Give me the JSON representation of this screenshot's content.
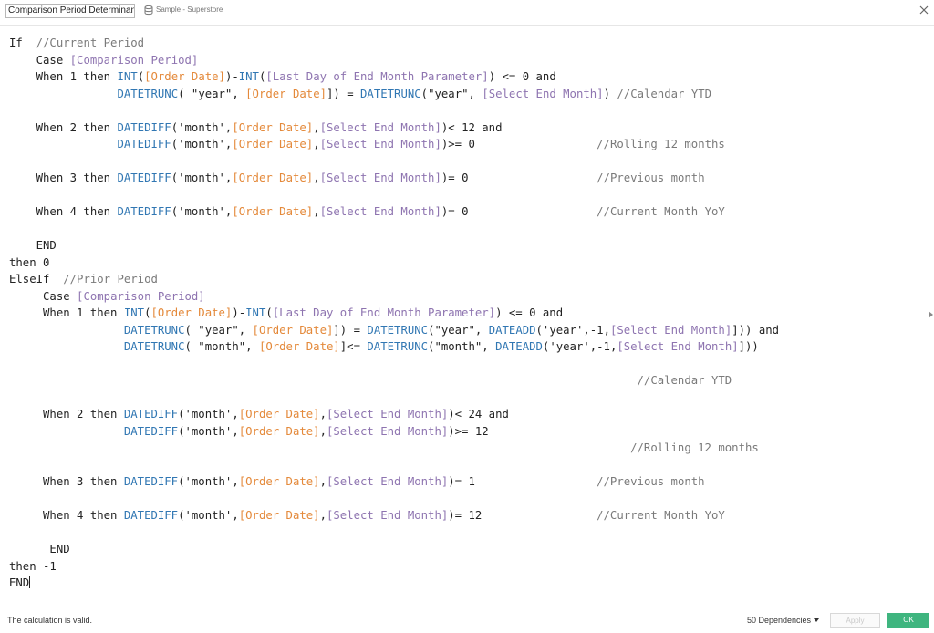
{
  "header": {
    "calculation_name": "Comparison Period Determinant",
    "data_source": "Sample - Superstore",
    "data_source_icon": "datasource-icon",
    "close_icon": "close-icon"
  },
  "code_lines": [
    [
      [
        "kw",
        "If  "
      ],
      [
        "comment",
        "//Current Period"
      ]
    ],
    [
      [
        "kw",
        "    Case "
      ],
      [
        "param",
        "[Comparison Period]"
      ]
    ],
    [
      [
        "kw",
        "    When 1 then "
      ],
      [
        "func",
        "INT"
      ],
      [
        "op",
        "("
      ],
      [
        "field",
        "[Order Date]"
      ],
      [
        "op",
        ")-"
      ],
      [
        "func",
        "INT"
      ],
      [
        "op",
        "("
      ],
      [
        "param",
        "[Last Day of End Month Parameter]"
      ],
      [
        "op",
        ") <= 0 and"
      ]
    ],
    [
      [
        "kw",
        "                "
      ],
      [
        "func",
        "DATETRUNC"
      ],
      [
        "op",
        "( \"year\", "
      ],
      [
        "field",
        "[Order Date]"
      ],
      [
        "op",
        "]) = "
      ],
      [
        "func",
        "DATETRUNC"
      ],
      [
        "op",
        "(\"year\", "
      ],
      [
        "param",
        "[Select End Month]"
      ],
      [
        "op",
        ") "
      ],
      [
        "comment",
        "//Calendar YTD"
      ]
    ],
    [
      [
        "kw",
        ""
      ]
    ],
    [
      [
        "kw",
        "    When 2 then "
      ],
      [
        "func",
        "DATEDIFF"
      ],
      [
        "op",
        "('month',"
      ],
      [
        "field",
        "[Order Date]"
      ],
      [
        "op",
        ","
      ],
      [
        "param",
        "[Select End Month]"
      ],
      [
        "op",
        ")< 12 and"
      ]
    ],
    [
      [
        "kw",
        "                "
      ],
      [
        "func",
        "DATEDIFF"
      ],
      [
        "op",
        "('month',"
      ],
      [
        "field",
        "[Order Date]"
      ],
      [
        "op",
        ","
      ],
      [
        "param",
        "[Select End Month]"
      ],
      [
        "op",
        ")>= 0                  "
      ],
      [
        "comment",
        "//Rolling 12 months"
      ]
    ],
    [
      [
        "kw",
        ""
      ]
    ],
    [
      [
        "kw",
        "    When 3 then "
      ],
      [
        "func",
        "DATEDIFF"
      ],
      [
        "op",
        "('month',"
      ],
      [
        "field",
        "[Order Date]"
      ],
      [
        "op",
        ","
      ],
      [
        "param",
        "[Select End Month]"
      ],
      [
        "op",
        ")= 0                   "
      ],
      [
        "comment",
        "//Previous month"
      ]
    ],
    [
      [
        "kw",
        ""
      ]
    ],
    [
      [
        "kw",
        "    When 4 then "
      ],
      [
        "func",
        "DATEDIFF"
      ],
      [
        "op",
        "('month',"
      ],
      [
        "field",
        "[Order Date]"
      ],
      [
        "op",
        ","
      ],
      [
        "param",
        "[Select End Month]"
      ],
      [
        "op",
        ")= 0                   "
      ],
      [
        "comment",
        "//Current Month YoY"
      ]
    ],
    [
      [
        "kw",
        ""
      ]
    ],
    [
      [
        "kw",
        "    END"
      ]
    ],
    [
      [
        "kw",
        "then 0"
      ]
    ],
    [
      [
        "kw",
        "ElseIf  "
      ],
      [
        "comment",
        "//Prior Period"
      ]
    ],
    [
      [
        "kw",
        "     Case "
      ],
      [
        "param",
        "[Comparison Period]"
      ]
    ],
    [
      [
        "kw",
        "     When 1 then "
      ],
      [
        "func",
        "INT"
      ],
      [
        "op",
        "("
      ],
      [
        "field",
        "[Order Date]"
      ],
      [
        "op",
        ")-"
      ],
      [
        "func",
        "INT"
      ],
      [
        "op",
        "("
      ],
      [
        "param",
        "[Last Day of End Month Parameter]"
      ],
      [
        "op",
        ") <= 0 and"
      ]
    ],
    [
      [
        "kw",
        "                 "
      ],
      [
        "func",
        "DATETRUNC"
      ],
      [
        "op",
        "( \"year\", "
      ],
      [
        "field",
        "[Order Date]"
      ],
      [
        "op",
        "]) = "
      ],
      [
        "func",
        "DATETRUNC"
      ],
      [
        "op",
        "(\"year\", "
      ],
      [
        "func",
        "DATEADD"
      ],
      [
        "op",
        "('year',-1,"
      ],
      [
        "param",
        "[Select End Month]"
      ],
      [
        "op",
        "])) and"
      ]
    ],
    [
      [
        "kw",
        "                 "
      ],
      [
        "func",
        "DATETRUNC"
      ],
      [
        "op",
        "( \"month\", "
      ],
      [
        "field",
        "[Order Date]"
      ],
      [
        "op",
        "]<= "
      ],
      [
        "func",
        "DATETRUNC"
      ],
      [
        "op",
        "(\"month\", "
      ],
      [
        "func",
        "DATEADD"
      ],
      [
        "op",
        "('year',-1,"
      ],
      [
        "param",
        "[Select End Month]"
      ],
      [
        "op",
        "]))"
      ]
    ],
    [
      [
        "kw",
        ""
      ]
    ],
    [
      [
        "kw",
        "                                                                                             "
      ],
      [
        "comment",
        "//Calendar YTD"
      ]
    ],
    [
      [
        "kw",
        ""
      ]
    ],
    [
      [
        "kw",
        "     When 2 then "
      ],
      [
        "func",
        "DATEDIFF"
      ],
      [
        "op",
        "('month',"
      ],
      [
        "field",
        "[Order Date]"
      ],
      [
        "op",
        ","
      ],
      [
        "param",
        "[Select End Month]"
      ],
      [
        "op",
        ")< 24 and"
      ]
    ],
    [
      [
        "kw",
        "                 "
      ],
      [
        "func",
        "DATEDIFF"
      ],
      [
        "op",
        "('month',"
      ],
      [
        "field",
        "[Order Date]"
      ],
      [
        "op",
        ","
      ],
      [
        "param",
        "[Select End Month]"
      ],
      [
        "op",
        ")>= 12"
      ]
    ],
    [
      [
        "kw",
        "                                                                                            "
      ],
      [
        "comment",
        "//Rolling 12 months"
      ]
    ],
    [
      [
        "kw",
        ""
      ]
    ],
    [
      [
        "kw",
        "     When 3 then "
      ],
      [
        "func",
        "DATEDIFF"
      ],
      [
        "op",
        "('month',"
      ],
      [
        "field",
        "[Order Date]"
      ],
      [
        "op",
        ","
      ],
      [
        "param",
        "[Select End Month]"
      ],
      [
        "op",
        ")= 1                  "
      ],
      [
        "comment",
        "//Previous month"
      ]
    ],
    [
      [
        "kw",
        ""
      ]
    ],
    [
      [
        "kw",
        "     When 4 then "
      ],
      [
        "func",
        "DATEDIFF"
      ],
      [
        "op",
        "('month',"
      ],
      [
        "field",
        "[Order Date]"
      ],
      [
        "op",
        ","
      ],
      [
        "param",
        "[Select End Month]"
      ],
      [
        "op",
        ")= 12                 "
      ],
      [
        "comment",
        "//Current Month YoY"
      ]
    ],
    [
      [
        "kw",
        ""
      ]
    ],
    [
      [
        "kw",
        "      END"
      ]
    ],
    [
      [
        "kw",
        "then -1"
      ]
    ],
    [
      [
        "kw",
        "END"
      ]
    ]
  ],
  "footer": {
    "status": "The calculation is valid.",
    "dependencies": "50 Dependencies",
    "apply_label": "Apply",
    "ok_label": "OK"
  },
  "colors": {
    "field": "#e4893a",
    "parameter": "#8e74b0",
    "function": "#3177b3",
    "comment": "#7a7a7a",
    "ok_button": "#3fb57f"
  }
}
